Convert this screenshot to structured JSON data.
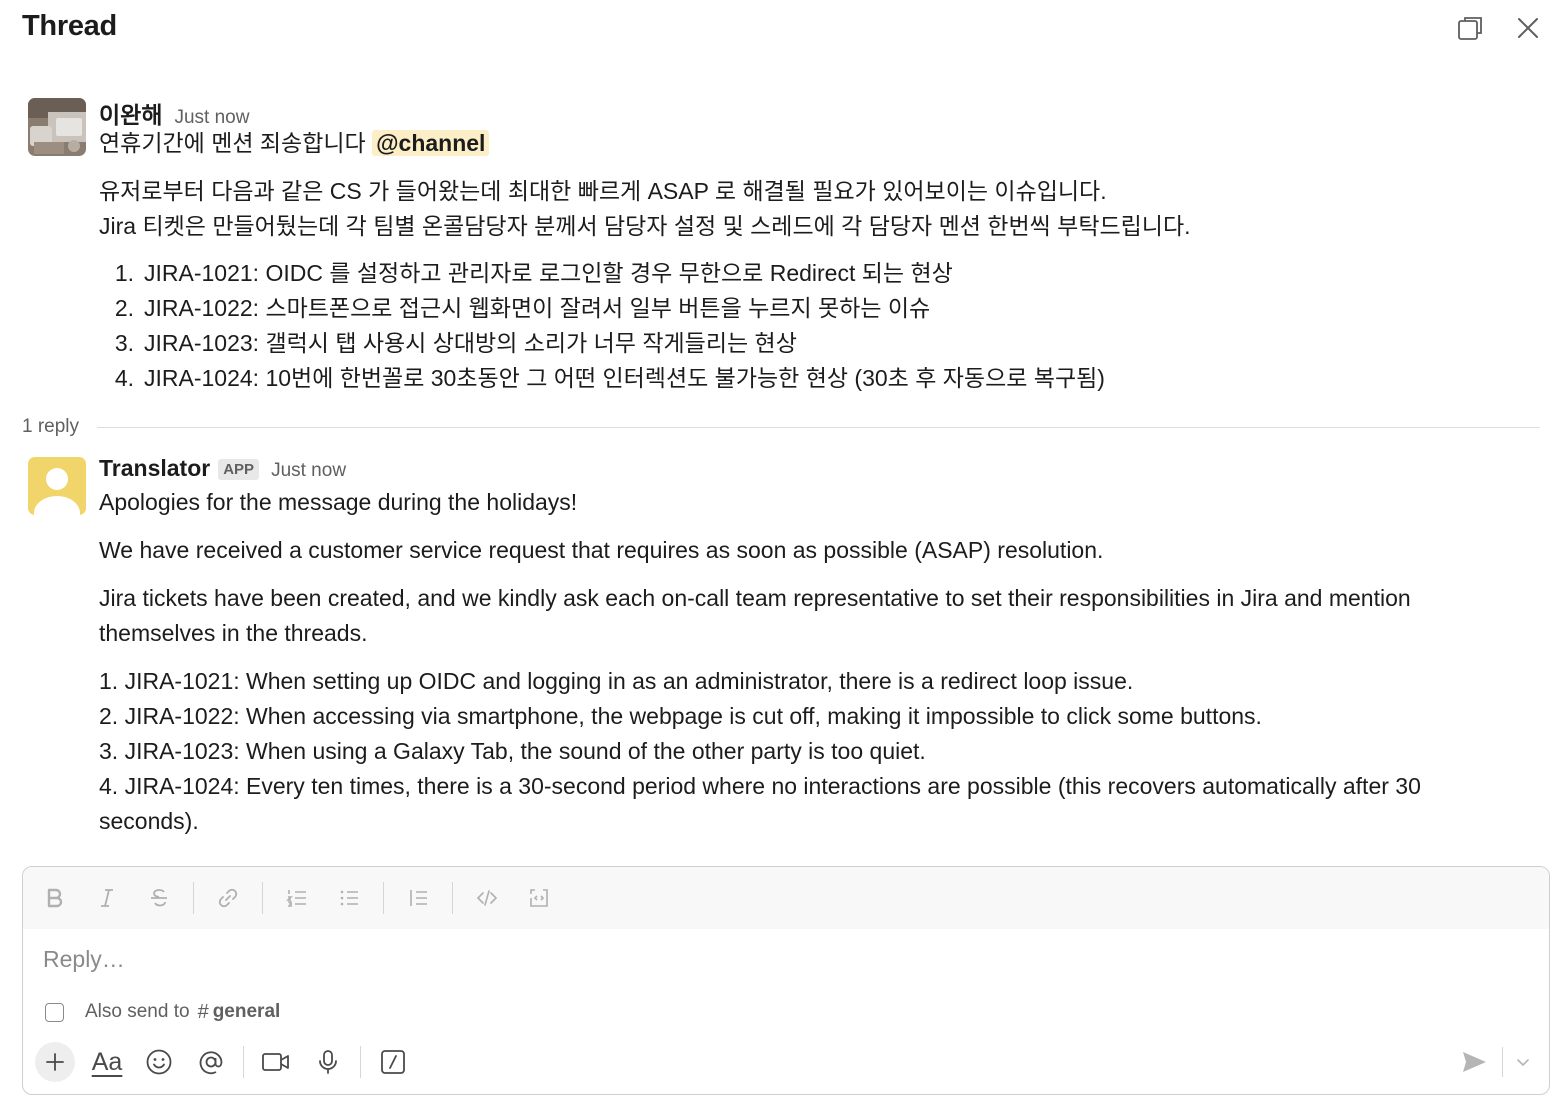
{
  "header": {
    "title": "Thread"
  },
  "parent_message": {
    "author": "이완해",
    "time": "Just now",
    "line1_text": "연휴기간에 멘션 죄송합니다 ",
    "mention": "@channel",
    "para1": "유저로부터 다음과 같은 CS 가 들어왔는데 최대한 빠르게 ASAP 로 해결될 필요가 있어보이는 이슈입니다.",
    "para2": "Jira 티켓은 만들어뒀는데 각 팀별 온콜담당자 분께서 담당자 설정 및 스레드에 각 담당자 멘션 한번씩 부탁드립니다.",
    "items": [
      {
        "num": "1.",
        "text": "JIRA-1021: OIDC 를 설정하고 관리자로 로그인할 경우 무한으로 Redirect 되는 현상"
      },
      {
        "num": "2.",
        "text": "JIRA-1022: 스마트폰으로 접근시 웹화면이 잘려서 일부 버튼을 누르지 못하는 이슈"
      },
      {
        "num": "3.",
        "text": "JIRA-1023: 갤럭시 탭 사용시 상대방의 소리가 너무 작게들리는 현상"
      },
      {
        "num": "4.",
        "text": "JIRA-1024: 10번에 한번꼴로 30초동안 그 어떤 인터렉션도 불가능한 현상 (30초 후 자동으로 복구됨)"
      }
    ]
  },
  "reply_count": "1 reply",
  "reply": {
    "author": "Translator",
    "badge": "APP",
    "time": "Just now",
    "p1": "Apologies for the message during the holidays!",
    "p2": "We have received a customer service request that requires as soon as possible (ASAP) resolution.",
    "p3": "Jira tickets have been created, and we kindly ask each on-call team representative to set their responsibilities in Jira and mention themselves in the threads.",
    "items": [
      "1. JIRA-1021: When setting up OIDC and logging in as an administrator, there is a redirect loop issue.",
      "2. JIRA-1022:  When accessing via smartphone, the webpage is cut off, making it impossible to click some buttons.",
      "3. JIRA-1023: When using a Galaxy Tab, the sound of the other party is too quiet.",
      "4. JIRA-1024: Every ten times, there is a 30-second period where no interactions are possible (this recovers automatically after 30 seconds)."
    ]
  },
  "composer": {
    "placeholder": "Reply…",
    "also_send_label": "Also send to",
    "hash": "#",
    "channel": "general",
    "also_send_checked": false,
    "format_icon": "Aa"
  },
  "colors": {
    "mention_bg": "#fcefc8",
    "translator_avatar": "#f1d56b",
    "muted_text": "#616061",
    "toolbar_bg": "#f8f8f8"
  },
  "icons": {
    "header": [
      "open-in-new-window-icon",
      "close-icon"
    ],
    "format_toolbar": [
      "bold-icon",
      "italic-icon",
      "strikethrough-icon",
      "link-icon",
      "ordered-list-icon",
      "bulleted-list-icon",
      "blockquote-icon",
      "code-icon",
      "code-block-icon"
    ],
    "action_toolbar": [
      "plus-icon",
      "text-format-icon",
      "emoji-icon",
      "mention-icon",
      "video-icon",
      "microphone-icon",
      "slash-command-icon",
      "send-icon",
      "chevron-down-icon"
    ]
  }
}
